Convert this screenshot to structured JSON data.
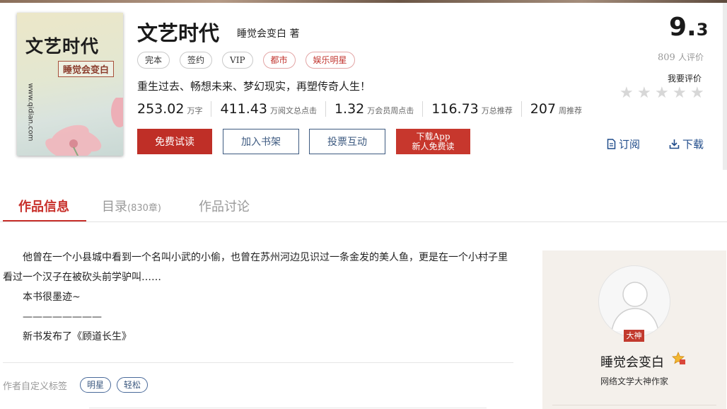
{
  "cover": {
    "title": "文艺时代",
    "author": "睡觉会变白",
    "site": "www.qidian.com"
  },
  "book": {
    "title": "文艺时代",
    "author_line": "睡觉会变白 著",
    "tags": [
      {
        "label": "完本",
        "style": "gray"
      },
      {
        "label": "签约",
        "style": "gray"
      },
      {
        "label": "VIP",
        "style": "gray"
      },
      {
        "label": "都市",
        "style": "red"
      },
      {
        "label": "娱乐明星",
        "style": "red"
      }
    ],
    "intro": "重生过去、畅想未来、梦幻现实，再塑传奇人生！",
    "stats": [
      {
        "value": "253.02",
        "unit": "万字"
      },
      {
        "value": "411.43",
        "unit": "万阅文总点击"
      },
      {
        "value": "1.32",
        "unit": "万会员周点击"
      },
      {
        "value": "116.73",
        "unit": "万总推荐"
      },
      {
        "value": "207",
        "unit": "周推荐"
      }
    ]
  },
  "buttons": {
    "read": "免费试读",
    "shelf": "加入书架",
    "vote": "投票互动",
    "app_line1": "下载App",
    "app_line2": "新人免费读"
  },
  "rating": {
    "score_int": "9.",
    "score_dec": "3",
    "count": "809",
    "count_unit": "人评价",
    "rate_label": "我要评价",
    "stars": 5
  },
  "links": {
    "subscribe": "订阅",
    "download": "下载"
  },
  "tabs": {
    "info": "作品信息",
    "catalog": "目录",
    "catalog_count": "(830章)",
    "discussion": "作品讨论"
  },
  "description": {
    "para1": "他曾在一个小县城中看到一个名叫小武的小偷，也曾在苏州河边见识过一条金发的美人鱼，更是在一个小村子里看过一个汉子在被砍头前学驴叫……",
    "para2": "本书很墨迹~",
    "para3": "————————",
    "para4": "新书发布了《顾道长生》"
  },
  "custom_tags": {
    "label": "作者自定义标签",
    "items": [
      "明星",
      "轻松"
    ]
  },
  "author_card": {
    "badge": "大神",
    "name": "睡觉会变白",
    "title": "网络文学大神作家"
  },
  "colors": {
    "accent_red": "#c8302b",
    "link_blue": "#3d5a80",
    "card_bg": "#f4f0eb"
  }
}
